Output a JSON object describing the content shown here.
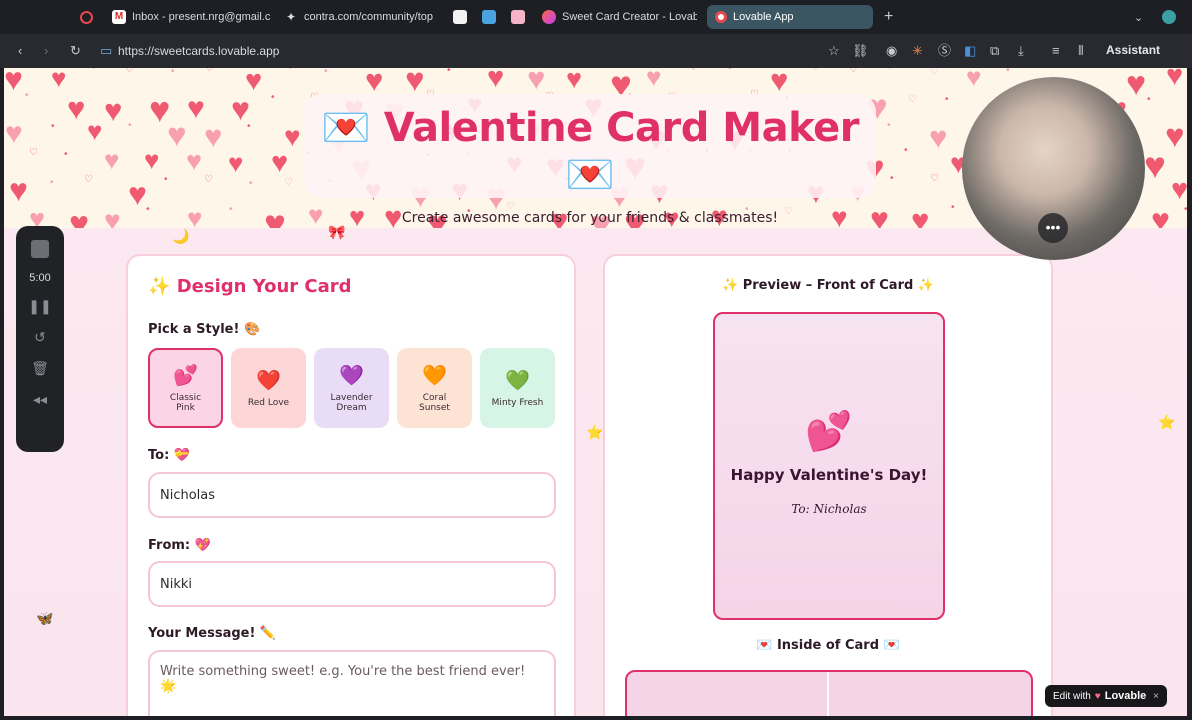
{
  "browser": {
    "tabs": [
      {
        "label": "",
        "icon": "record-icon"
      },
      {
        "label": "Inbox - present.nrg@gmail.c",
        "icon": "gmail-icon"
      },
      {
        "label": "contra.com/community/top",
        "icon": "contra-icon"
      },
      {
        "label": "",
        "icon": "white-square-icon"
      },
      {
        "label": "",
        "icon": "blue-square-icon"
      },
      {
        "label": "",
        "icon": "pink-square-icon"
      },
      {
        "label": "Sweet Card Creator - Lovab",
        "icon": "lovable-icon"
      },
      {
        "label": "Lovable App",
        "icon": "lovable-app-icon"
      }
    ],
    "url": "https://sweetcards.lovable.app",
    "assistant_label": "Assistant"
  },
  "header": {
    "title": "Valentine Card Maker",
    "title_emoji": "💌",
    "subtitle": "Create awesome cards for your friends & classmates!"
  },
  "design": {
    "heading": "Design Your Card",
    "heading_emoji": "✨",
    "style_label": "Pick a Style! 🎨",
    "styles": [
      {
        "label": "Classic Pink",
        "emoji": "💕",
        "bg": "#fbd4e6",
        "selected": true
      },
      {
        "label": "Red Love",
        "emoji": "❤️",
        "bg": "#fcd6d6",
        "selected": false
      },
      {
        "label": "Lavender Dream",
        "emoji": "💜",
        "bg": "#e9dcf7",
        "selected": false
      },
      {
        "label": "Coral Sunset",
        "emoji": "🧡",
        "bg": "#fde3d4",
        "selected": false
      },
      {
        "label": "Minty Fresh",
        "emoji": "💚",
        "bg": "#d7f5e6",
        "selected": false
      }
    ],
    "to_label": "To: 💝",
    "to_value": "Nicholas",
    "from_label": "From: 💖",
    "from_value": "Nikki",
    "message_label": "Your Message! ✏️",
    "message_placeholder": "Write something sweet! e.g. You're the best friend ever! 🌟"
  },
  "preview": {
    "front_title": "✨ Preview – Front of Card ✨",
    "front_emoji": "💕",
    "greeting": "Happy Valentine's Day!",
    "to_line": "To: Nicholas",
    "inside_title": "💌 Inside of Card 💌"
  },
  "recorder": {
    "time": "5:00"
  },
  "badge": {
    "edit_with": "Edit with",
    "brand": "Lovable",
    "close": "×"
  },
  "colors": {
    "accent": "#e0306a",
    "heart": "#f05a70",
    "page_bg": "#fde8f0"
  }
}
